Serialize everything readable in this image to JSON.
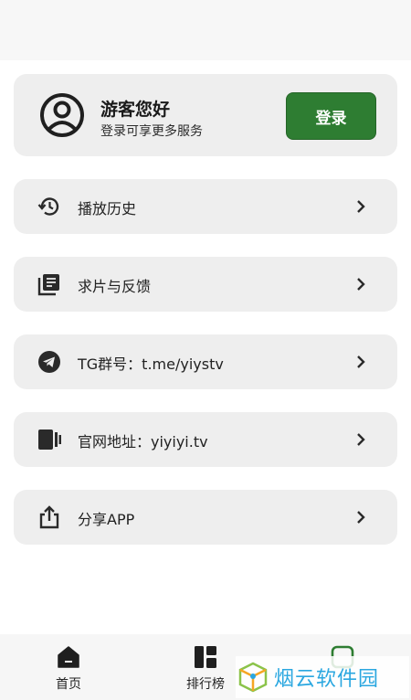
{
  "profile": {
    "greeting": "游客您好",
    "subtitle": "登录可享更多服务",
    "login_label": "登录"
  },
  "menu": [
    {
      "icon": "history-icon",
      "label": "播放历史"
    },
    {
      "icon": "feedback-icon",
      "label": "求片与反馈"
    },
    {
      "icon": "telegram-icon",
      "label": "TG群号：t.me/yiystv"
    },
    {
      "icon": "website-icon",
      "label": "官网地址：yiyiyi.tv"
    },
    {
      "icon": "share-icon",
      "label": "分享APP"
    }
  ],
  "bottom_nav": [
    {
      "icon": "home-icon",
      "label": "首页"
    },
    {
      "icon": "ranking-icon",
      "label": "排行榜"
    }
  ],
  "watermark": {
    "text": "烟云软件园"
  },
  "colors": {
    "accent": "#2e7d32",
    "card": "#eeeeee",
    "watermark": "#2aa7e0"
  }
}
